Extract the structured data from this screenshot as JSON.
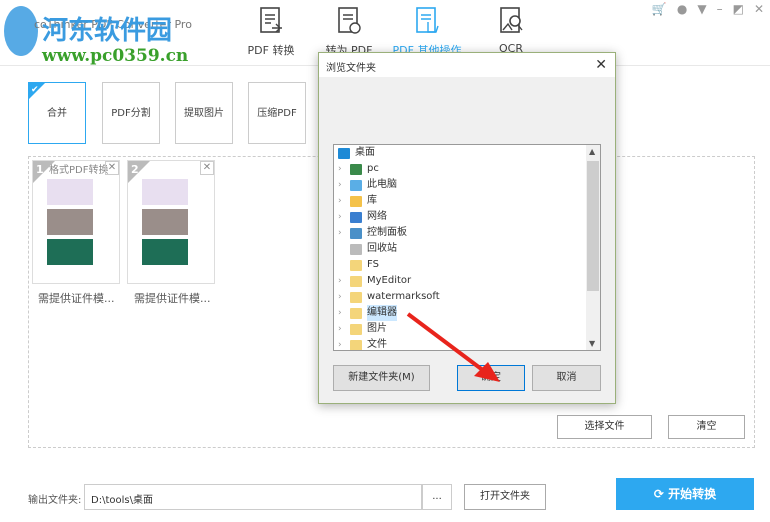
{
  "app": {
    "title": "coThinker PDF Converter Pro",
    "watermark": "河东软件园",
    "watermark_url": "www.pc0359.cn"
  },
  "nav": [
    {
      "label": "PDF 转换"
    },
    {
      "label": "转为 PDF"
    },
    {
      "label": "PDF 其他操作"
    },
    {
      "label": "OCR"
    }
  ],
  "tools": [
    {
      "label": "合并"
    },
    {
      "label": "PDF分割"
    },
    {
      "label": "提取图片"
    },
    {
      "label": "压缩PDF"
    }
  ],
  "files": [
    {
      "num": "1",
      "name": "需提供证件模...",
      "overlay": "格式PDF转换"
    },
    {
      "num": "2",
      "name": "需提供证件模..."
    }
  ],
  "buttons": {
    "select": "选择文件",
    "clear": "清空",
    "open": "打开文件夹",
    "browse": "...",
    "start": "开始转换"
  },
  "output": {
    "label": "输出文件夹:",
    "value": "D:\\tools\\桌面"
  },
  "dialog": {
    "title": "浏览文件夹",
    "new_folder": "新建文件夹(M)",
    "ok": "确定",
    "cancel": "取消",
    "items": [
      {
        "label": "桌面",
        "icon": "desktop"
      },
      {
        "label": "pc",
        "icon": "user"
      },
      {
        "label": "此电脑",
        "icon": "computer"
      },
      {
        "label": "库",
        "icon": "library"
      },
      {
        "label": "网络",
        "icon": "network"
      },
      {
        "label": "控制面板",
        "icon": "control-panel"
      },
      {
        "label": "回收站",
        "icon": "recycle-bin"
      },
      {
        "label": "FS",
        "icon": "folder"
      },
      {
        "label": "MyEditor",
        "icon": "folder"
      },
      {
        "label": "watermarksoft",
        "icon": "folder"
      },
      {
        "label": "编辑器",
        "icon": "folder"
      },
      {
        "label": "图片",
        "icon": "folder"
      },
      {
        "label": "文件",
        "icon": "folder"
      }
    ]
  },
  "colors": {
    "accent": "#2da8f0",
    "arrow": "#e8241c"
  }
}
